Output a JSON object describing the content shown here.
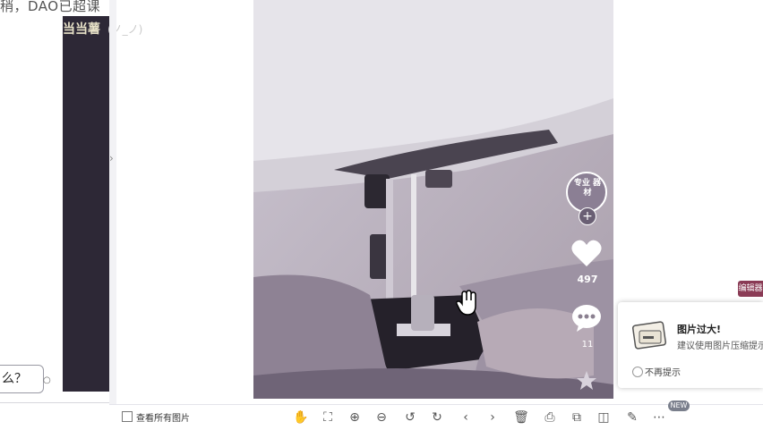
{
  "editor": {
    "top_text": "稍，DAO已超课",
    "strip_text": "当当薯",
    "strip_subtext": "(ノ_ノ)",
    "bubble_text": "么？"
  },
  "post": {
    "avatar_text": "专业 器材",
    "likes": "497",
    "comments": "11"
  },
  "notice": {
    "title": "图片过大!",
    "desc": "建议使用图片压缩提示",
    "checkbox_label": "不再提示"
  },
  "side_tag": "编辑器",
  "toolbar": {
    "view_all": "查看所有图片",
    "new_badge": "NEW"
  },
  "toolbar_icons": [
    "hand-icon",
    "fit-screen-icon",
    "zoom-in-icon",
    "zoom-out-icon",
    "rotate-left-icon",
    "rotate-right-icon",
    "prev-icon",
    "next-icon",
    "delete-icon",
    "print-icon",
    "copy-icon",
    "compare-icon",
    "edit-icon",
    "more-icon"
  ],
  "colors": {
    "dark_strip": "#2d2836",
    "tag": "#8a3b55",
    "badge": "#7a7f8c"
  }
}
